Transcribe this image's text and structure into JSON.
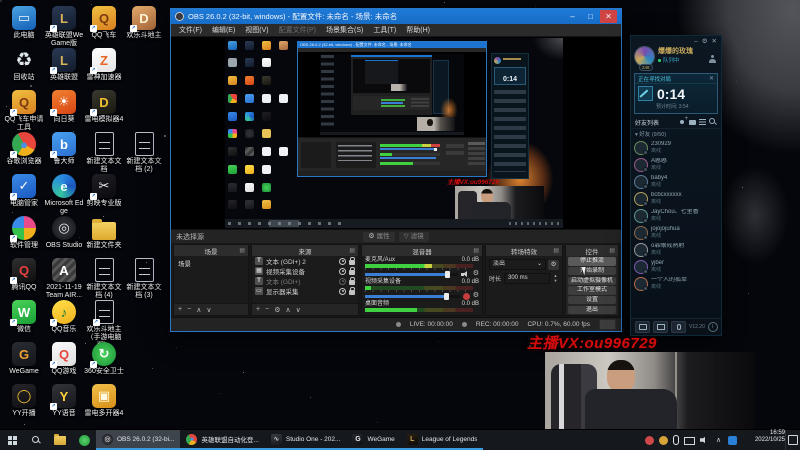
{
  "desktop": {
    "icons": [
      {
        "label": "此电脑",
        "col": 0,
        "row": 0,
        "kind": "tile",
        "bg": "linear-gradient(160deg,#4aa3e0,#1460b8)",
        "fg": "#eaf4ff",
        "glyph": "▭",
        "sc": false,
        "icon_name": "this-pc-icon"
      },
      {
        "label": "英雄联盟WeGame版",
        "col": 1,
        "row": 0,
        "kind": "tile",
        "bg": "linear-gradient(160deg,#2a3a55,#121b2b)",
        "fg": "#d8b45a",
        "glyph": "L",
        "sc": true,
        "icon_name": "lol-wegame-icon"
      },
      {
        "label": "QQ飞车",
        "col": 2,
        "row": 0,
        "kind": "tile",
        "bg": "linear-gradient(160deg,#f0c040,#d87f20)",
        "fg": "#7a3a10",
        "glyph": "Q",
        "sc": true,
        "icon_name": "qq-speed-icon"
      },
      {
        "label": "欢乐斗地主",
        "col": 3,
        "row": 0,
        "kind": "tile",
        "bg": "linear-gradient(160deg,#e0a86a,#a8683a)",
        "fg": "#fff4d8",
        "glyph": "D",
        "sc": true,
        "icon_name": "doudizhu-icon"
      },
      {
        "label": "回收站",
        "col": 0,
        "row": 1,
        "kind": "plain",
        "bg": "transparent",
        "fg": "#dfe8ee",
        "glyph": "♻",
        "sc": false,
        "icon_name": "recycle-bin-icon"
      },
      {
        "label": "英雄联盟",
        "col": 1,
        "row": 1,
        "kind": "tile",
        "bg": "linear-gradient(160deg,#2a3a55,#121b2b)",
        "fg": "#d8b45a",
        "glyph": "L",
        "sc": true,
        "icon_name": "lol-icon"
      },
      {
        "label": "雷神加速器",
        "col": 2,
        "row": 1,
        "kind": "tile",
        "bg": "linear-gradient(160deg,#ffffff,#e4e4e4)",
        "fg": "#e86420",
        "glyph": "Z",
        "sc": true,
        "icon_name": "leigod-icon"
      },
      {
        "label": "QQ飞车申请工具",
        "col": 0,
        "row": 2,
        "kind": "tile",
        "bg": "linear-gradient(160deg,#f0c040,#d87f20)",
        "fg": "#7a3a10",
        "glyph": "Q",
        "sc": true,
        "icon_name": "qq-speed-tool-icon"
      },
      {
        "label": "向日葵",
        "col": 1,
        "row": 2,
        "kind": "tile",
        "bg": "linear-gradient(160deg,#f08030,#d84515)",
        "fg": "#ffffff",
        "glyph": "☀",
        "sc": true,
        "icon_name": "sunlogin-icon"
      },
      {
        "label": "雷电模拟器4",
        "col": 2,
        "row": 2,
        "kind": "tile",
        "bg": "linear-gradient(160deg,#3a3a30,#171710)",
        "fg": "#f0c030",
        "glyph": "D",
        "sc": true,
        "icon_name": "ldplayer-icon"
      },
      {
        "label": "谷歌浏览器",
        "col": 0,
        "row": 3,
        "kind": "circle",
        "bg": "conic-gradient(#e8453c 0 120deg,#f0b01e 120deg 210deg,#34a853 210deg 330deg,#e8453c 330deg)",
        "fg": "#4a90e8",
        "glyph": "●",
        "sc": true,
        "icon_name": "chrome-icon"
      },
      {
        "label": "鲁大师",
        "col": 1,
        "row": 3,
        "kind": "tile",
        "bg": "linear-gradient(160deg,#4aa0f0,#2a6fd0)",
        "fg": "#ffffff",
        "glyph": "b",
        "sc": true,
        "icon_name": "ludashi-icon"
      },
      {
        "label": "新建文本文档",
        "col": 2,
        "row": 3,
        "kind": "doc",
        "sc": false,
        "icon_name": "text-file-icon"
      },
      {
        "label": "新建文本文档 (2)",
        "col": 3,
        "row": 3,
        "kind": "doc",
        "sc": false,
        "icon_name": "text-file-icon"
      },
      {
        "label": "电脑管家",
        "col": 0,
        "row": 4,
        "kind": "tile",
        "bg": "linear-gradient(160deg,#3a8ae8,#1a59c0)",
        "fg": "#ffffff",
        "glyph": "✓",
        "sc": true,
        "icon_name": "pc-manager-icon"
      },
      {
        "label": "Microsoft Edge",
        "col": 1,
        "row": 4,
        "kind": "circle",
        "bg": "conic-gradient(from 200deg,#35c4a0,#2a8ae0 40%,#1a56c0 70%,#35c4a0)",
        "fg": "#eaffff",
        "glyph": "e",
        "sc": false,
        "icon_name": "edge-icon"
      },
      {
        "label": "剪映专业版",
        "col": 2,
        "row": 4,
        "kind": "tile",
        "bg": "linear-gradient(160deg,#202024,#0b0b0f)",
        "fg": "#f0f0f0",
        "glyph": "✂",
        "sc": true,
        "icon_name": "jianying-icon"
      },
      {
        "label": "软件管理",
        "col": 0,
        "row": 5,
        "kind": "circle",
        "bg": "conic-gradient(#e84a8a 0 90deg,#f0b01e 90deg 180deg,#35c24a 180deg 270deg,#3a8ae8 270deg)",
        "fg": "#ffffff",
        "glyph": "",
        "sc": true,
        "icon_name": "software-manager-icon"
      },
      {
        "label": "OBS Studio",
        "col": 1,
        "row": 5,
        "kind": "circle",
        "bg": "radial-gradient(circle,#2c2c34 40%,#0e0e12)",
        "fg": "#e8e8f0",
        "glyph": "◎",
        "sc": false,
        "icon_name": "obs-studio-icon"
      },
      {
        "label": "新建文件夹",
        "col": 2,
        "row": 5,
        "kind": "folder",
        "sc": false,
        "icon_name": "folder-icon"
      },
      {
        "label": "腾讯QQ",
        "col": 0,
        "row": 6,
        "kind": "tile",
        "bg": "linear-gradient(160deg,#303030,#0e0e0e)",
        "fg": "#e84040",
        "glyph": "Q",
        "sc": true,
        "icon_name": "qq-icon"
      },
      {
        "label": "2021-11-19 Team AIR...",
        "col": 1,
        "row": 6,
        "kind": "tile",
        "bg": "repeating-linear-gradient(135deg,#3a3a3a 0 3px,#585858 3px 6px)",
        "fg": "#ffffff",
        "glyph": "A",
        "sc": false,
        "icon_name": "team-air-icon"
      },
      {
        "label": "新建文本文档 (4)",
        "col": 2,
        "row": 6,
        "kind": "doc",
        "sc": false,
        "icon_name": "text-file-icon"
      },
      {
        "label": "新建文本文档 (3)",
        "col": 3,
        "row": 6,
        "kind": "doc",
        "sc": false,
        "icon_name": "text-file-icon"
      },
      {
        "label": "微信",
        "col": 0,
        "row": 7,
        "kind": "tile",
        "bg": "linear-gradient(160deg,#4ad25a,#18a035)",
        "fg": "#ffffff",
        "glyph": "W",
        "sc": true,
        "icon_name": "wechat-icon"
      },
      {
        "label": "QQ音乐",
        "col": 1,
        "row": 7,
        "kind": "circle",
        "bg": "linear-gradient(160deg,#ffe04a,#f0b01e)",
        "fg": "#157a3a",
        "glyph": "♪",
        "sc": true,
        "icon_name": "qq-music-icon"
      },
      {
        "label": "欢乐斗地主（手游电脑版）",
        "col": 2,
        "row": 7,
        "kind": "doc",
        "sc": true,
        "icon_name": "doudizhu-mobile-icon"
      },
      {
        "label": "WeGame",
        "col": 0,
        "row": 8,
        "kind": "tile",
        "bg": "linear-gradient(160deg,#2a2d33,#13151a)",
        "fg": "#f0a030",
        "glyph": "G",
        "sc": false,
        "icon_name": "wegame-icon"
      },
      {
        "label": "QQ游戏",
        "col": 1,
        "row": 8,
        "kind": "tile",
        "bg": "linear-gradient(160deg,#fafafa,#dedede)",
        "fg": "#e8453c",
        "glyph": "Q",
        "sc": true,
        "icon_name": "qq-game-icon"
      },
      {
        "label": "360安全卫士",
        "col": 2,
        "row": 8,
        "kind": "circle",
        "bg": "radial-gradient(circle,#4ad25a,#189038)",
        "fg": "#ffffff",
        "glyph": "↻",
        "sc": true,
        "icon_name": "360-safe-icon"
      },
      {
        "label": "YY开播",
        "col": 0,
        "row": 9,
        "kind": "tile",
        "bg": "linear-gradient(160deg,#26262a,#0d0d11)",
        "fg": "#f0c030",
        "glyph": "◯",
        "sc": false,
        "icon_name": "yy-broadcast-icon"
      },
      {
        "label": "YY语音",
        "col": 1,
        "row": 9,
        "kind": "tile",
        "bg": "linear-gradient(160deg,#33343a,#16171b)",
        "fg": "#ffd23c",
        "glyph": "Y",
        "sc": true,
        "icon_name": "yy-voice-icon"
      },
      {
        "label": "雷电多开器4",
        "col": 2,
        "row": 9,
        "kind": "tile",
        "bg": "linear-gradient(160deg,#f0c04a,#d88f18)",
        "fg": "#fff8e0",
        "glyph": "▣",
        "sc": false,
        "icon_name": "ld-multi-icon"
      }
    ]
  },
  "obs": {
    "title": "OBS 26.0.2 (32-bit, windows) - 配置文件: 未命名 - 场景: 未命名",
    "window_buttons": {
      "min": "–",
      "max": "□",
      "close": "✕"
    },
    "menus": [
      "文件(F)",
      "编辑(E)",
      "视图(V)",
      "配置文件(P)",
      "场景集合(S)",
      "工具(T)",
      "帮助(H)"
    ],
    "no_source": "未选择源",
    "properties_btn": "属性",
    "filters_btn": "滤镜",
    "scenes": {
      "title": "场景",
      "items": [
        "场景"
      ],
      "footer": [
        "+",
        "−",
        "∧",
        "∨"
      ]
    },
    "sources": {
      "title": "来源",
      "footer": [
        "+",
        "−",
        "⚙",
        "∧",
        "∨"
      ],
      "items": [
        {
          "glyph": "T",
          "label": "文本 (GDI+) 2",
          "dim": false
        },
        {
          "glyph": "▦",
          "label": "视频采集设备",
          "dim": false
        },
        {
          "glyph": "T",
          "label": "文本 (GDI+)",
          "dim": true
        },
        {
          "glyph": "▭",
          "label": "显示器采集",
          "dim": false
        }
      ]
    },
    "mixer": {
      "title": "混音器",
      "channels": [
        {
          "name": "麦克风/Aux",
          "db": "0.0 dB",
          "level": 62,
          "slider": 88,
          "muted": false
        },
        {
          "name": "视频采集设备",
          "db": "0.0 dB",
          "level": 6,
          "slider": 85,
          "muted": true
        },
        {
          "name": "桌面音频",
          "db": "0.0 dB",
          "level": 48,
          "slider": null,
          "muted": false
        }
      ]
    },
    "transitions": {
      "title": "转场特效",
      "type": "淡出",
      "duration_label": "时长",
      "duration": "300 ms"
    },
    "controls": {
      "title": "控件",
      "buttons": [
        "停止推流",
        "开始录制",
        "启动虚拟摄像机",
        "工作室模式",
        "设置",
        "退出"
      ]
    },
    "status": {
      "live": "LIVE: 00:00:00",
      "rec": "REC: 00:00:00",
      "cpu": "CPU: 0.7%, 60.00 fps"
    }
  },
  "lol": {
    "window_buttons": {
      "min": "–",
      "gear": "⚙",
      "close": "✕"
    },
    "player": {
      "name": "爆爆的玫瑰",
      "level": "248",
      "status": "队列中"
    },
    "queue": {
      "title": "正在寻找对局",
      "close": "✕",
      "timer": "0:14",
      "estimate": "预计时间: 3:54"
    },
    "friends_header": "好友列表",
    "group_label": "▾ 好友 (9/50)",
    "friends": [
      {
        "name": "230929",
        "status": "离线",
        "ring": "#6a8a5a"
      },
      {
        "name": "A憨憨",
        "status": "离线",
        "ring": "#9a5a8a"
      },
      {
        "name": "baby4",
        "status": "离线",
        "ring": "#5a7a9a"
      },
      {
        "name": "bcbcxxxxxx",
        "status": "离线",
        "ring": "#b0a05a"
      },
      {
        "name": "JayChou、七里香",
        "status": "离线",
        "ring": "#5a9a8a"
      },
      {
        "name": "jojojojuhua",
        "status": "离线",
        "ring": "#8a6a4a"
      },
      {
        "name": "o靠眼戒熟射",
        "status": "离线",
        "ring": "#9a9a9a"
      },
      {
        "name": "yjber",
        "status": "离线",
        "ring": "#7a5ab0"
      },
      {
        "name": "一个人的孤单",
        "status": "离线",
        "ring": "#b06a4a"
      }
    ],
    "version": "V12.20",
    "info_glyph": "i"
  },
  "overlay": {
    "vx_text": "主播VX:ou996729"
  },
  "taskbar": {
    "apps": [
      {
        "label": "OBS 26.0.2 (32-bi...",
        "active": true,
        "icon": {
          "bg": "radial-gradient(circle,#3a3a42 35%,#0d0d11)",
          "fg": "#f0f0f0",
          "glyph": "◎",
          "round": true
        },
        "icon_name": "obs-taskbar-icon"
      },
      {
        "label": "英雄联盟自动化登...",
        "active": false,
        "icon": {
          "bg": "conic-gradient(#e8453c 0 120deg,#f0b01e 120deg 210deg,#34a853 210deg 330deg,#e8453c 330deg)",
          "fg": "#4a90e8",
          "glyph": "●",
          "round": true
        },
        "icon_name": "chrome-taskbar-icon"
      },
      {
        "label": "Studio One - 202...",
        "active": false,
        "icon": {
          "bg": "linear-gradient(160deg,#3a3d44,#16171b)",
          "fg": "#c8ccd4",
          "glyph": "∿",
          "round": false
        },
        "icon_name": "studio-one-taskbar-icon"
      },
      {
        "label": "WeGame",
        "active": false,
        "icon": {
          "bg": "linear-gradient(160deg,#25272d,#0f1013)",
          "fg": "#e8ecf2",
          "glyph": "G",
          "round": false
        },
        "icon_name": "wegame-taskbar-icon"
      },
      {
        "label": "League of Legends",
        "active": false,
        "icon": {
          "bg": "linear-gradient(160deg,#2a2013,#0e0a06)",
          "fg": "#c8a85a",
          "glyph": "L",
          "round": false
        },
        "icon_name": "lol-taskbar-icon"
      }
    ],
    "tray": [
      {
        "shape": "circle",
        "color": "#cf4848",
        "name": "tray-red-icon"
      },
      {
        "shape": "circle",
        "color": "#d8a23a",
        "name": "tray-gold-icon"
      },
      {
        "shape": "mic",
        "color": "#e4eaee",
        "name": "tray-mic-icon"
      },
      {
        "shape": "monitor",
        "color": "#cfd8de",
        "name": "tray-monitor-icon"
      },
      {
        "shape": "speaker",
        "color": "#cfd8de",
        "name": "tray-speaker-icon"
      },
      {
        "shape": "glyph",
        "glyph": "∧",
        "color": "#cfd8de",
        "name": "tray-up-arrow-icon"
      },
      {
        "shape": "square",
        "color": "#2a7fd6",
        "name": "tray-blue-icon"
      }
    ],
    "clock_time": "16:59",
    "clock_date": "2022/10/25"
  }
}
